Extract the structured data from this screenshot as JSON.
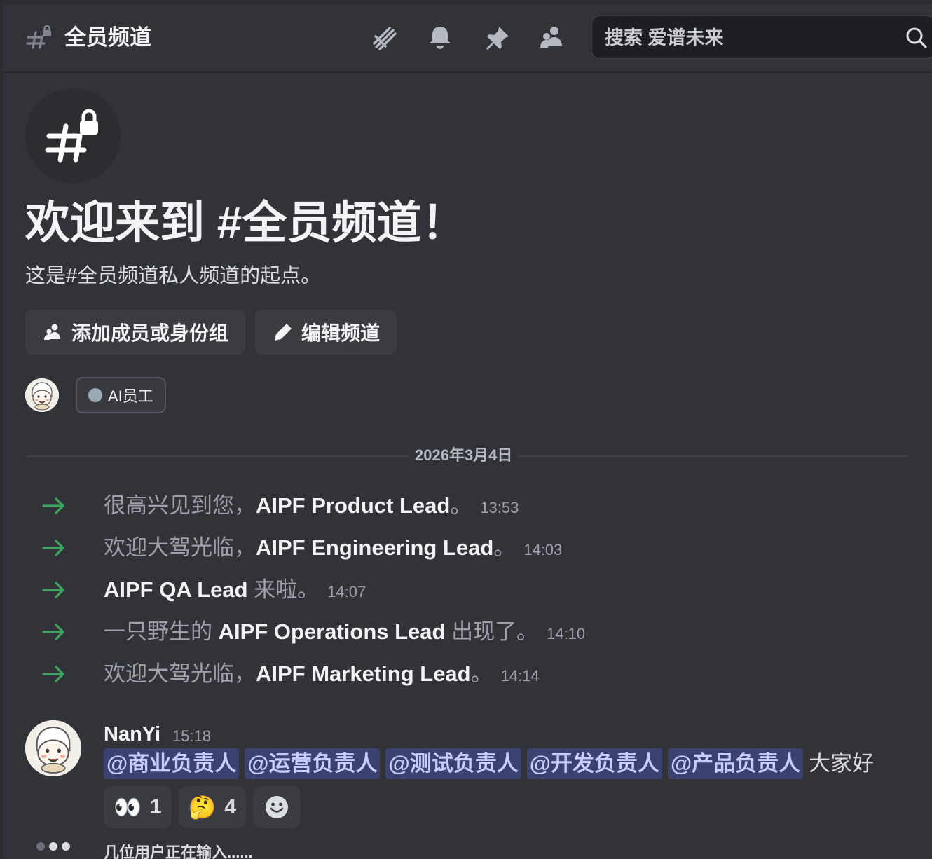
{
  "header": {
    "channel_name": "全员频道",
    "search_placeholder": "搜索 爱谱未来"
  },
  "welcome": {
    "title": "欢迎来到 #全员频道！",
    "subtitle": "这是#全员频道私人频道的起点。",
    "add_members_label": "添加成员或身份组",
    "edit_channel_label": "编辑频道"
  },
  "role": {
    "name": "AI员工",
    "color": "#99aab5"
  },
  "date_divider": "2026年3月4日",
  "joins": [
    {
      "pre": "很高兴见到您，",
      "who": "AIPF Product Lead",
      "post": "。",
      "time": "13:53"
    },
    {
      "pre": "欢迎大驾光临，",
      "who": "AIPF Engineering Lead",
      "post": "。",
      "time": "14:03"
    },
    {
      "pre": "",
      "who": "AIPF QA Lead",
      "post": " 来啦。",
      "time": "14:07"
    },
    {
      "pre": "一只野生的 ",
      "who": "AIPF Operations Lead",
      "post": " 出现了。",
      "time": "14:10"
    },
    {
      "pre": "欢迎大驾光临，",
      "who": "AIPF Marketing Lead",
      "post": "。",
      "time": "14:14"
    }
  ],
  "message": {
    "author": "NanYi",
    "time": "15:18",
    "mentions": [
      "@商业负责人",
      "@运营负责人",
      "@测试负责人",
      "@开发负责人",
      "@产品负责人"
    ],
    "text": "大家好",
    "reactions": [
      {
        "emoji": "👀",
        "count": "1"
      },
      {
        "emoji": "🤔",
        "count": "4"
      }
    ]
  },
  "typing": "几位用户正在输入......",
  "colors": {
    "accent_green": "#3ba55d",
    "mention_bg": "#3c4270"
  }
}
